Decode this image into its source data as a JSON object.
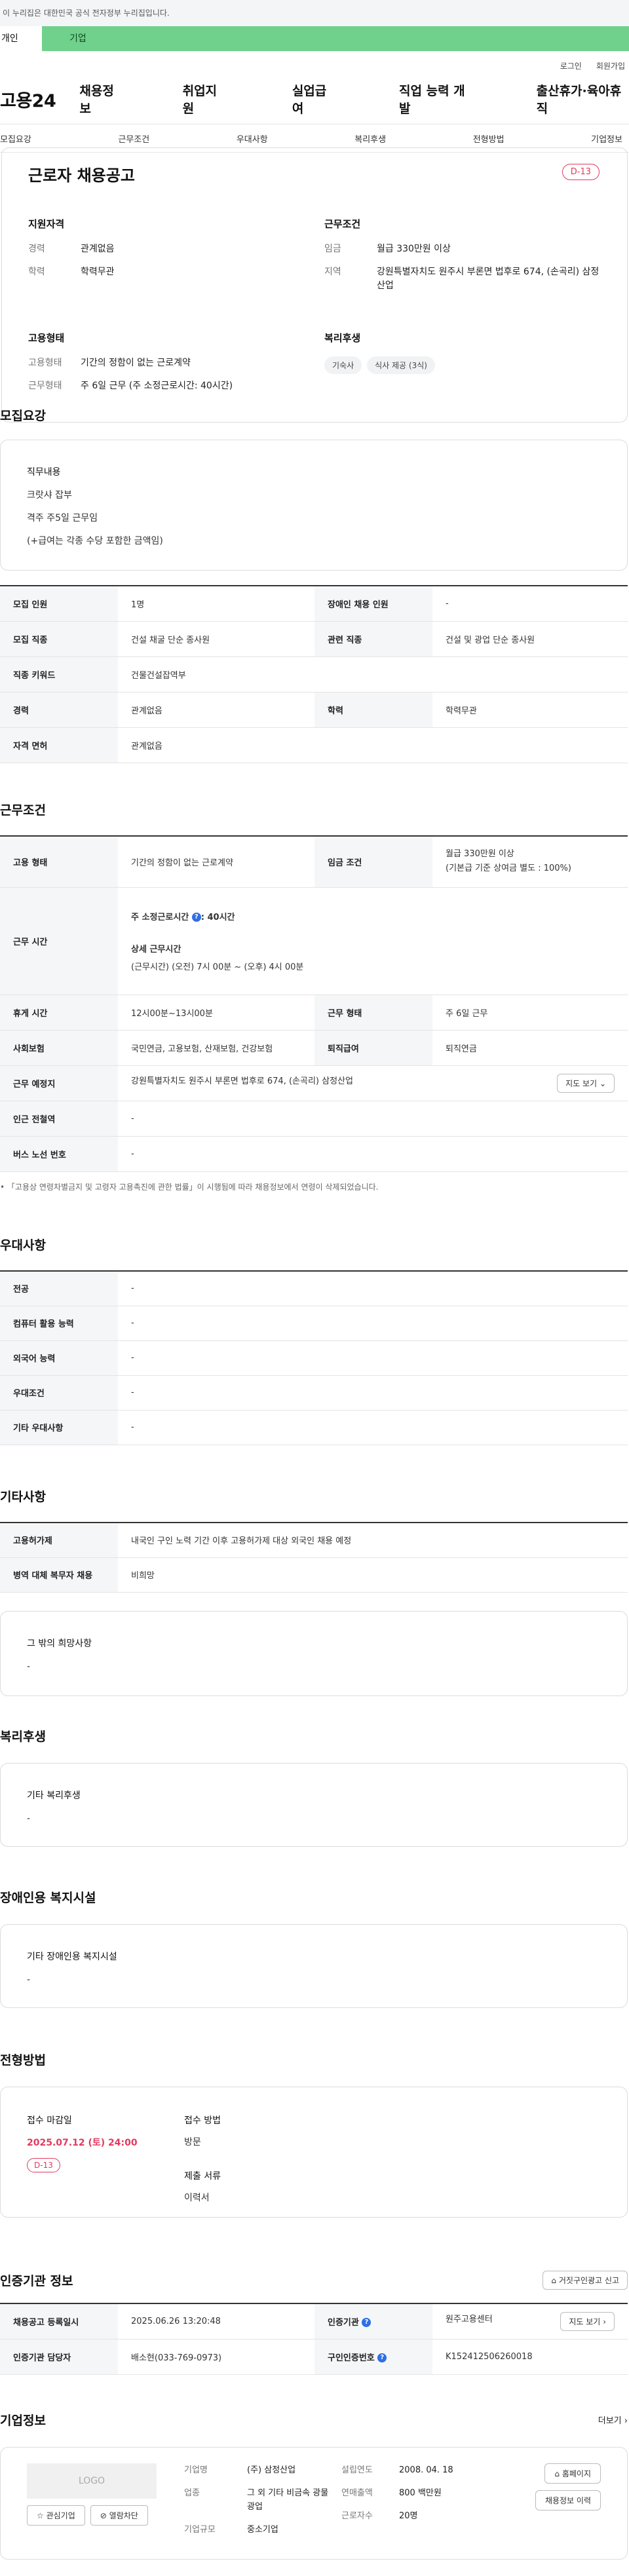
{
  "gov_strip": "이 누리집은 대한민국 공식 전자정부 누리집입니다.",
  "user_tabs": {
    "person": "개인",
    "company": "기업"
  },
  "util": {
    "login": "로그인",
    "join": "회원가입"
  },
  "logo": "고용24",
  "gnb": [
    "채용정보",
    "취업지원",
    "실업급여",
    "직업 능력 개발",
    "출산휴가·육아휴직"
  ],
  "anchor_nav": [
    "모집요강",
    "근무조건",
    "우대사항",
    "복리후생",
    "전형방법",
    "기업정보"
  ],
  "summary": {
    "title": "근로자 채용공고",
    "dday": "D-13",
    "qual": {
      "heading": "지원자격",
      "rows": [
        {
          "k": "경력",
          "v": "관계없음"
        },
        {
          "k": "학력",
          "v": "학력무관"
        }
      ]
    },
    "cond": {
      "heading": "근무조건",
      "rows": [
        {
          "k": "임금",
          "v": "월급 330만원 이상"
        },
        {
          "k": "지역",
          "v": "강원특별자치도 원주시 부론면 법후로 674, (손곡리) 삼정산업"
        }
      ]
    },
    "emp": {
      "heading": "고용형태",
      "rows": [
        {
          "k": "고용형태",
          "v": "기간의 정함이 없는 근로계약"
        },
        {
          "k": "근무형태",
          "v": "주 6일 근무 (주 소정근로시간: 40시간)"
        }
      ]
    },
    "welfare": {
      "heading": "복리후생",
      "chips": [
        "기숙사",
        "식사 제공 (3식)"
      ]
    }
  },
  "recruit": {
    "title": "모집요강",
    "duty_heading": "직무내용",
    "duty_lines": [
      "크랏샤 잡부",
      "격주 주5일 근무임",
      "(+급여는 각종 수당 포함한 금액임)"
    ],
    "table": {
      "headcount_k": "모집 인원",
      "headcount_v": "1명",
      "disabled_k": "장애인 채용 인원",
      "disabled_v": "-",
      "job_k": "모집 직종",
      "job_v": "건설 채굴 단순 종사원",
      "related_k": "관련 직종",
      "related_v": "건설 및 광업 단순 종사원",
      "keyword_k": "직종 키워드",
      "keyword_v": "건물건설잡역부",
      "career_k": "경력",
      "career_v": "관계없음",
      "edu_k": "학력",
      "edu_v": "학력무관",
      "license_k": "자격 면허",
      "license_v": "관계없음"
    }
  },
  "work": {
    "title": "근무조건",
    "type_k": "고용 형태",
    "type_v": "기간의 정함이 없는 근로계약",
    "wage_k": "임금 조건",
    "wage_v1": "월급 330만원 이상",
    "wage_v2": "(기본급 기준 상여금 별도 : 100%)",
    "hours_k": "근무 시간",
    "hours_weekly": "주 소정근로시간",
    "hours_weekly_v": ": 40시간",
    "hours_detail_h": "상세 근무시간",
    "hours_detail_v": "(근무시간) (오전) 7시 00분 ~ (오후) 4시 00분",
    "rest_k": "휴게 시간",
    "rest_v": "12시00분~13시00분",
    "form_k": "근무 형태",
    "form_v": "주 6일 근무",
    "ins_k": "사회보험",
    "ins_v": "국민연금, 고용보험, 산재보험, 건강보험",
    "sev_k": "퇴직급여",
    "sev_v": "퇴직연금",
    "place_k": "근무 예정지",
    "place_v": "강원특별자치도 원주시 부론면 법후로 674, (손곡리) 삼정산업",
    "map_btn": "지도 보기",
    "subway_k": "인근 전철역",
    "subway_v": "-",
    "bus_k": "버스 노선 번호",
    "bus_v": "-",
    "note": "「고용상 연령차별금지 및 고령자 고용촉진에 관한 법률」이 시행됨에 따라 채용정보에서 연령이 삭제되었습니다."
  },
  "prefer": {
    "title": "우대사항",
    "rows": [
      {
        "k": "전공",
        "v": "-"
      },
      {
        "k": "컴퓨터 활용 능력",
        "v": "-"
      },
      {
        "k": "외국어 능력",
        "v": "-"
      },
      {
        "k": "우대조건",
        "v": "-"
      },
      {
        "k": "기타 우대사항",
        "v": "-"
      }
    ]
  },
  "etc": {
    "title": "기타사항",
    "hire_k": "고용허가제",
    "hire_v": "내국인 구인 노력 기간 이후 고용허가제 대상 외국인 채용 예정",
    "military_k": "병역 대체 복무자 채용",
    "military_v": "비희망",
    "other_h": "그 밖의 희망사항",
    "other_v": "-"
  },
  "welfare": {
    "title": "복리후생",
    "box_h": "기타 복리후생",
    "box_v": "-"
  },
  "disabled_fac": {
    "title": "장애인용 복지시설",
    "box_h": "기타 장애인용 복지시설",
    "box_v": "-"
  },
  "selection": {
    "title": "전형방법",
    "deadline_h": "접수 마감일",
    "deadline_v": "2025.07.12 (토) 24:00",
    "dday": "D-13",
    "method_h": "접수 방법",
    "method_v": "방문",
    "docs_h": "제출 서류",
    "docs_v": "이력서"
  },
  "agency": {
    "title": "인증기관 정보",
    "report_btn": "거짓구인광고 신고",
    "reg_k": "채용공고 등록일시",
    "reg_v": "2025.06.26 13:20:48",
    "inst_k": "인증기관",
    "inst_v": "원주고용센터",
    "map_btn": "지도 보기",
    "staff_k": "인증기관 담당자",
    "staff_v": "배소현(033-769-0973)",
    "no_k": "구인인증번호",
    "no_v": "K152412506260018"
  },
  "company": {
    "title": "기업정보",
    "more": "더보기",
    "logo_placeholder": "LOGO",
    "fav_btn": "관심기업",
    "block_btn": "열람차단",
    "name_k": "기업명",
    "name_v": "(주) 삼정산업",
    "biz_k": "업종",
    "biz_v": "그 외 기타 비금속 광물 광업",
    "size_k": "기업규모",
    "size_v": "중소기업",
    "est_k": "설립연도",
    "est_v": "2008. 04. 18",
    "sales_k": "연매출액",
    "sales_v": "800 백만원",
    "emp_k": "근로자수",
    "emp_v": "20명",
    "home_btn": "홈페이지",
    "history_btn": "채용정보 이력"
  },
  "colors": {
    "accent_green": "#6fd18b",
    "dday_red": "#e23b5f",
    "blue": "#2f6fe4"
  }
}
